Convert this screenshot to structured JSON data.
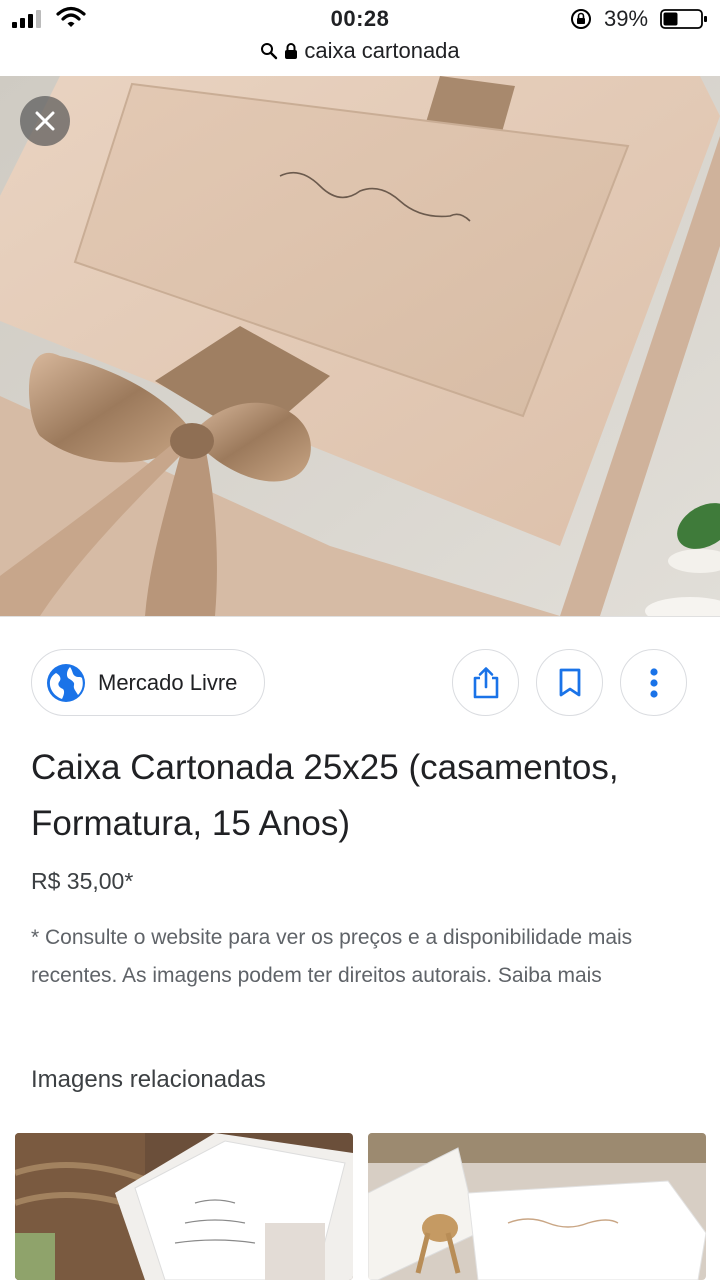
{
  "status_bar": {
    "time": "00:28",
    "battery_percent": "39%",
    "battery_level": 0.39,
    "icons": [
      "signal-icon",
      "wifi-icon",
      "rotation-lock-icon",
      "battery-icon"
    ]
  },
  "url_bar": {
    "text": "caixa cartonada",
    "icons": [
      "search-icon",
      "lock-icon"
    ]
  },
  "hero": {
    "close_icon": "close-icon"
  },
  "source": {
    "label": "Mercado Livre",
    "icon": "globe-icon"
  },
  "actions": {
    "share_icon": "share-icon",
    "save_icon": "bookmark-icon",
    "more_icon": "more-vert-icon"
  },
  "product": {
    "title": "Caixa Cartonada 25x25 (casamentos, Formatura, 15 Anos)",
    "price": "R$ 35,00*",
    "disclaimer": "* Consulte o website para ver os preços e a disponibilidade mais recentes. As imagens podem ter direitos autorais. Saiba mais"
  },
  "related": {
    "heading": "Imagens relacionadas"
  },
  "colors": {
    "accent_blue": "#1a73e8",
    "text_primary": "#202124",
    "text_secondary": "#5f6368",
    "border": "#dadce0"
  }
}
